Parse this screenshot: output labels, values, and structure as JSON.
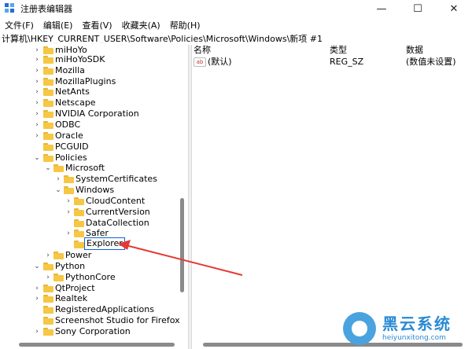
{
  "window": {
    "title": "注册表编辑器",
    "minimize_glyph": "—",
    "maximize_glyph": "☐",
    "close_glyph": "✕"
  },
  "menu": [
    {
      "label": "文件(F)"
    },
    {
      "label": "编辑(E)"
    },
    {
      "label": "查看(V)"
    },
    {
      "label": "收藏夹(A)"
    },
    {
      "label": "帮助(H)"
    }
  ],
  "address": "计算机\\HKEY_CURRENT_USER\\Software\\Policies\\Microsoft\\Windows\\新项 #1",
  "tree": [
    {
      "label": "miHoYo"
    },
    {
      "label": "miHoYoSDK"
    },
    {
      "label": "Mozilla"
    },
    {
      "label": "MozillaPlugins"
    },
    {
      "label": "NetAnts"
    },
    {
      "label": "Netscape"
    },
    {
      "label": "NVIDIA Corporation"
    },
    {
      "label": "ODBC"
    },
    {
      "label": "Oracle"
    },
    {
      "label": "PCGUID"
    },
    {
      "label": "Policies"
    },
    {
      "label": "Microsoft"
    },
    {
      "label": "SystemCertificates"
    },
    {
      "label": "Windows"
    },
    {
      "label": "CloudContent"
    },
    {
      "label": "CurrentVersion"
    },
    {
      "label": "DataCollection"
    },
    {
      "label": "Safer"
    },
    {
      "label": "Explorer"
    },
    {
      "label": "Power"
    },
    {
      "label": "Python"
    },
    {
      "label": "PythonCore"
    },
    {
      "label": "QtProject"
    },
    {
      "label": "Realtek"
    },
    {
      "label": "RegisteredApplications"
    },
    {
      "label": "Screenshot Studio for Firefox"
    },
    {
      "label": "Sony Corporation"
    }
  ],
  "list": {
    "columns": [
      "名称",
      "类型",
      "数据"
    ],
    "rows": [
      {
        "icon": "ab",
        "name": "(默认)",
        "type": "REG_SZ",
        "data": "(数值未设置)"
      }
    ]
  },
  "watermark": {
    "title": "黑云系统",
    "url": "heiyunxitong.com"
  },
  "colors": {
    "folder": "#f6c744",
    "annotation_arrow": "#e53935",
    "watermark": "#2a8ad4"
  }
}
